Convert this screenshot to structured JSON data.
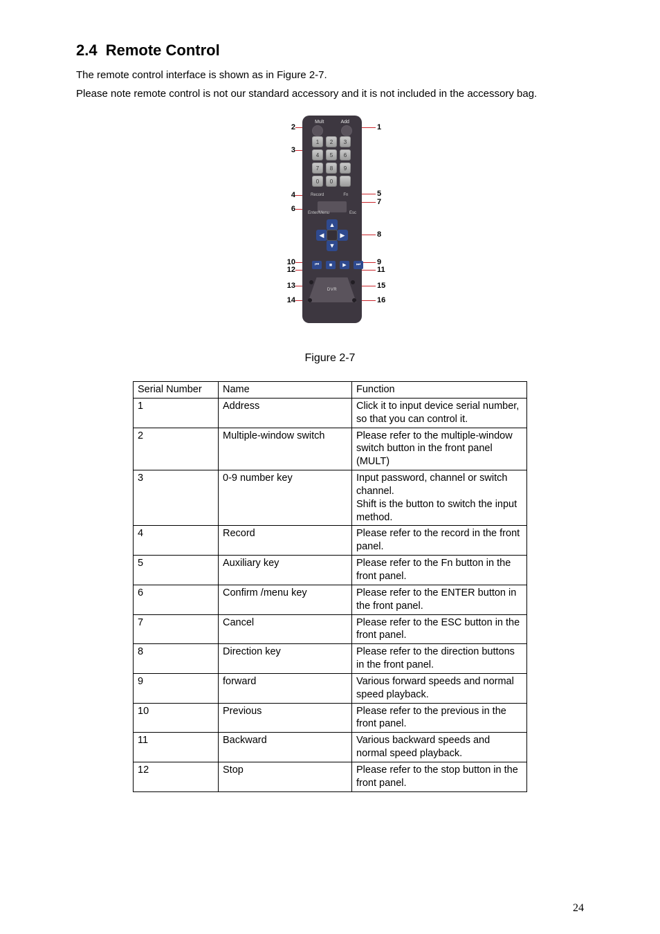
{
  "heading": {
    "number": "2.4",
    "title": "Remote Control"
  },
  "paragraphs": [
    "The remote control interface is shown as in Figure 2-7.",
    "Please note remote control is not our standard accessory and it is not included in the accessory bag."
  ],
  "figure": {
    "caption": "Figure 2-7",
    "top_labels": {
      "left": "Mult",
      "right": "Add"
    },
    "callouts": [
      {
        "id": "1",
        "side": "right"
      },
      {
        "id": "2",
        "side": "left"
      },
      {
        "id": "3",
        "side": "left"
      },
      {
        "id": "4",
        "side": "left"
      },
      {
        "id": "5",
        "side": "right"
      },
      {
        "id": "6",
        "side": "left"
      },
      {
        "id": "7",
        "side": "right"
      },
      {
        "id": "8",
        "side": "right"
      },
      {
        "id": "9",
        "side": "right"
      },
      {
        "id": "10",
        "side": "left"
      },
      {
        "id": "11",
        "side": "right"
      },
      {
        "id": "12",
        "side": "left"
      },
      {
        "id": "13",
        "side": "left"
      },
      {
        "id": "14",
        "side": "left"
      },
      {
        "id": "15",
        "side": "right"
      },
      {
        "id": "16",
        "side": "right"
      }
    ]
  },
  "table": {
    "headers": [
      "Serial Number",
      "Name",
      "Function"
    ],
    "rows": [
      {
        "sn": "1",
        "name": "Address",
        "fn": "Click it to input device serial number, so that you can control it."
      },
      {
        "sn": "2",
        "name": "Multiple-window switch",
        "fn": "Please refer to the multiple-window switch button in the front panel (MULT)"
      },
      {
        "sn": "3",
        "name": "0-9 number key",
        "fn": "Input password, channel or switch channel.\nShift is the button to switch the input method."
      },
      {
        "sn": "4",
        "name": "Record",
        "fn": "Please refer to the record in the front panel."
      },
      {
        "sn": "5",
        "name": "Auxiliary  key",
        "fn": "Please refer to the Fn button in the front panel."
      },
      {
        "sn": "6",
        "name": "Confirm /menu key",
        "fn": "Please refer to the ENTER button in the front panel."
      },
      {
        "sn": "7",
        "name": "Cancel",
        "fn": "Please refer to the ESC button in the front panel."
      },
      {
        "sn": "8",
        "name": "Direction key",
        "fn": "Please refer to the direction buttons in the front panel."
      },
      {
        "sn": "9",
        "name": "forward",
        "fn": "Various forward speeds and normal speed playback."
      },
      {
        "sn": "10",
        "name": "Previous",
        "fn": "Please refer to the previous in the front panel."
      },
      {
        "sn": "11",
        "name": "Backward",
        "fn": "Various backward speeds and normal speed playback."
      },
      {
        "sn": "12",
        "name": "Stop",
        "fn": "Please refer to the stop button in the front panel."
      }
    ]
  },
  "page_number": "24"
}
